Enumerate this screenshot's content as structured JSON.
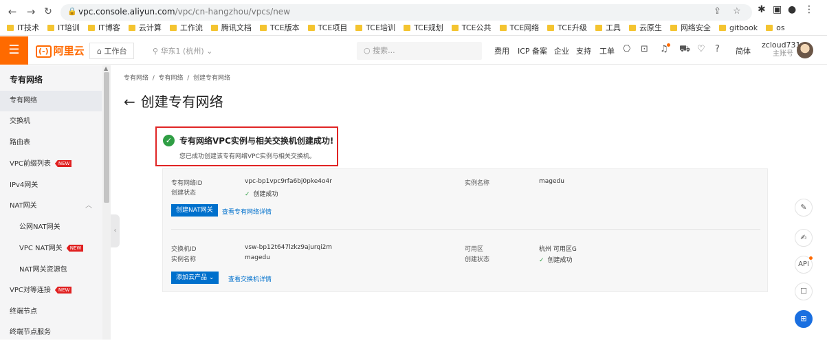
{
  "browser": {
    "url_host": "vpc.console.aliyun.com",
    "url_path": "/vpc/cn-hangzhou/vpcs/new",
    "bookmarks": [
      "IT技术",
      "IT培训",
      "IT博客",
      "云计算",
      "工作流",
      "腾讯文档",
      "TCE版本",
      "TCE项目",
      "TCE培训",
      "TCE规划",
      "TCE公共",
      "TCE网络",
      "TCE升级",
      "工具",
      "云原生",
      "网络安全",
      "gitbook",
      "os"
    ]
  },
  "topbar": {
    "logo": "阿里云",
    "logo_mark": "(-)",
    "workbench": "工作台",
    "region": "华东1 (杭州)",
    "search_placeholder": "搜索...",
    "links": [
      "费用",
      "ICP 备案",
      "企业",
      "支持",
      "工单"
    ],
    "lang": "简体",
    "username": "zcloud731",
    "role": "主账号"
  },
  "sidebar": {
    "title": "专有网络",
    "items": [
      {
        "label": "专有网络"
      },
      {
        "label": "交换机"
      },
      {
        "label": "路由表"
      },
      {
        "label": "VPC前缀列表",
        "badge": "NEW"
      },
      {
        "label": "IPv4网关"
      },
      {
        "label": "NAT网关"
      },
      {
        "label": "公网NAT网关"
      },
      {
        "label": "VPC NAT网关",
        "badge": "NEW"
      },
      {
        "label": "NAT网关资源包"
      },
      {
        "label": "VPC对等连接",
        "badge": "NEW"
      },
      {
        "label": "终端节点"
      },
      {
        "label": "终端节点服务"
      }
    ]
  },
  "main": {
    "breadcrumb": [
      "专有网络",
      "专有网络",
      "创建专有网络"
    ],
    "title": "创建专有网络",
    "success_title": "专有网络VPC实例与相关交换机创建成功!",
    "success_desc": "您已成功创建该专有网络VPC实例与相关交换机。",
    "vpc": {
      "id_label": "专有网络ID",
      "id_value": "vpc-bp1vpc9rfa6bj0pke4o4r",
      "status_label": "创建状态",
      "status_value": "创建成功",
      "name_label": "实例名称",
      "name_value": "magedu",
      "btn_nat": "创建NAT网关",
      "link_detail": "查看专有网络详情"
    },
    "vsw": {
      "id_label": "交换机ID",
      "id_value": "vsw-bp12t647lzkz9ajurqi2m",
      "name_label": "实例名称",
      "name_value": "magedu",
      "zone_label": "可用区",
      "zone_value": "杭州 可用区G",
      "status_label": "创建状态",
      "status_value": "创建成功",
      "btn_add": "添加云产品",
      "link_detail": "查看交换机详情"
    }
  },
  "float_tools": [
    "edit-icon",
    "notes-icon",
    "API",
    "chat-icon",
    "apps-icon"
  ],
  "float_api_label": "API",
  "colors": {
    "accent": "#ff6a00",
    "primary": "#0070cc",
    "success": "#2f9e44",
    "highlight": "#e02424"
  }
}
